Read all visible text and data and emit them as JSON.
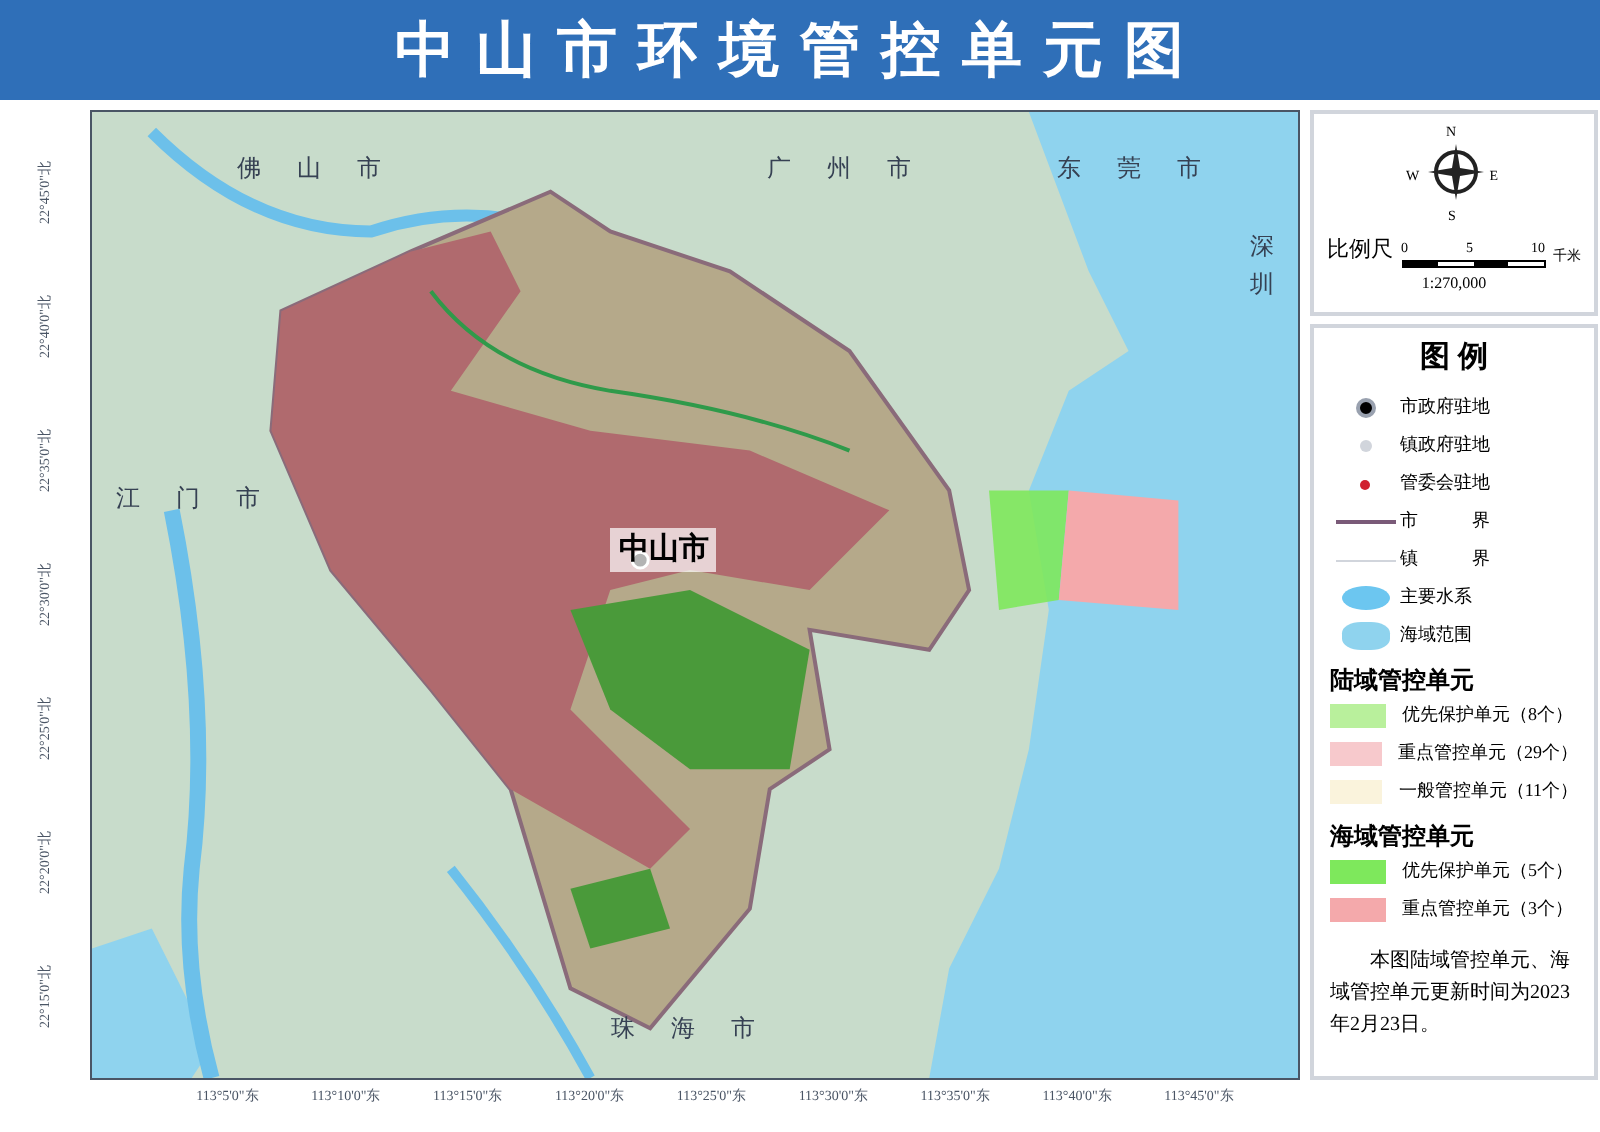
{
  "title": "中山市环境管控单元图",
  "map_labels": [
    {
      "text": "佛山市"
    },
    {
      "text": "广州市"
    },
    {
      "text": "东莞市"
    },
    {
      "text": "深圳"
    },
    {
      "text": "江门市"
    },
    {
      "text": "珠海市"
    },
    {
      "text": "中山市"
    }
  ],
  "latitude_ticks": [
    "22°45'0\"北",
    "22°40'0\"北",
    "22°35'0\"北",
    "22°30'0\"北",
    "22°25'0\"北",
    "22°20'0\"北",
    "22°15'0\"北"
  ],
  "longitude_ticks": [
    "113°5'0\"东",
    "113°10'0\"东",
    "113°15'0\"东",
    "113°20'0\"东",
    "113°25'0\"东",
    "113°30'0\"东",
    "113°35'0\"东",
    "113°40'0\"东",
    "113°45'0\"东"
  ],
  "compass": {
    "n": "N",
    "s": "S",
    "w": "W",
    "e": "E"
  },
  "scale": {
    "label": "比例尺",
    "ticks": [
      "0",
      "5",
      "10"
    ],
    "unit": "千米",
    "ratio": "1:270,000"
  },
  "legend": {
    "title": "图 例",
    "symbols": [
      {
        "kind": "city-seat",
        "label": "市政府驻地"
      },
      {
        "kind": "town-seat",
        "label": "镇政府驻地"
      },
      {
        "kind": "committee-seat",
        "label": "管委会驻地"
      },
      {
        "kind": "city-boundary",
        "label": "市　　　界"
      },
      {
        "kind": "town-boundary",
        "label": "镇　　　界"
      },
      {
        "kind": "water",
        "label": "主要水系"
      },
      {
        "kind": "sea",
        "label": "海域范围"
      }
    ],
    "sections": [
      {
        "title": "陆域管控单元",
        "items": [
          {
            "label": "优先保护单元（8个）",
            "color": "#b9f09c"
          },
          {
            "label": "重点管控单元（29个）",
            "color": "#f7c9cc"
          },
          {
            "label": "一般管控单元（11个）",
            "color": "#faf3dc"
          }
        ]
      },
      {
        "title": "海域管控单元",
        "items": [
          {
            "label": "优先保护单元（5个）",
            "color": "#7ee85c"
          },
          {
            "label": "重点管控单元（3个）",
            "color": "#f4a9ab"
          }
        ]
      }
    ],
    "note": "本图陆域管控单元、海域管控单元更新时间为2023年2月23日。"
  }
}
